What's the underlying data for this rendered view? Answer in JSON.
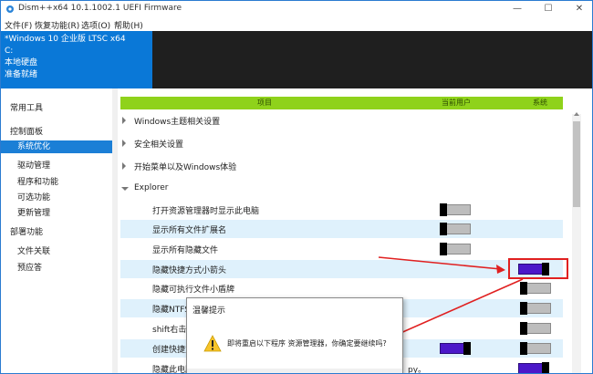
{
  "window": {
    "title": "Dism++x64 10.1.1002.1 UEFI Firmware",
    "minimize": "—",
    "maximize": "☐",
    "close": "✕",
    "icon": "dism-gear-icon"
  },
  "menu": {
    "items": [
      "文件(F)",
      "恢复功能(R)",
      "选项(O)",
      "帮助(H)"
    ]
  },
  "image_panel": {
    "name": "*Windows 10 企业版 LTSC x64",
    "drive": "C:",
    "disk": "本地硬盘",
    "status": "准备就绪"
  },
  "sidebar": {
    "tools": "常用工具",
    "control_panel": "控制面板",
    "items": [
      "系统优化",
      "驱动管理",
      "程序和功能",
      "可选功能",
      "更新管理"
    ],
    "deploy": "部署功能",
    "deploy_items": [
      "文件关联",
      "预应答"
    ]
  },
  "table": {
    "headers": {
      "item": "项目",
      "current_user": "当前用户",
      "system": "系统"
    },
    "groups": [
      "Windows主题相关设置",
      "安全相关设置",
      "开始菜单以及Windows体验",
      "Explorer"
    ],
    "rows": [
      {
        "label": "打开资源管理器时显示此电脑",
        "user": "off",
        "system": ""
      },
      {
        "label": "显示所有文件扩展名",
        "user": "off",
        "system": ""
      },
      {
        "label": "显示所有隐藏文件",
        "user": "off",
        "system": ""
      },
      {
        "label": "隐藏快捷方式小箭头",
        "user": "",
        "system": "on"
      },
      {
        "label": "隐藏可执行文件小盾牌",
        "user": "",
        "system": "off"
      },
      {
        "label": "隐藏NTFS",
        "user": "",
        "system": "off"
      },
      {
        "label": "shift右击",
        "user": "",
        "system": "off"
      },
      {
        "label": "创建快捷方",
        "user": "on",
        "system": "off"
      },
      {
        "label": "隐藏此电脑",
        "label_tail": "py。",
        "user": "",
        "system": "on"
      }
    ]
  },
  "dialog": {
    "title": "温馨提示",
    "message": "即将重启以下程序 资源管理器，你确定要继续吗?",
    "icon": "warning-icon"
  },
  "colors": {
    "accent": "#0a78d7",
    "header_green": "#8fd21b",
    "toggle_on": "#4b18c9",
    "annotation_red": "#e02020"
  }
}
